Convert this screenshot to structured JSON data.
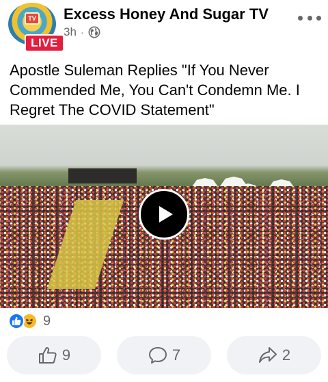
{
  "post": {
    "page_name": "Excess Honey And Sugar TV",
    "time": "3h",
    "meta_separator": "·",
    "live_label": "LIVE",
    "avatar_badge_text": "TV",
    "text": "Apostle Suleman Replies \"If You Never Commended Me, You Can't Condemn Me. I Regret The COVID Statement\""
  },
  "reactions": {
    "count": "9"
  },
  "actions": {
    "like_count": "9",
    "comment_count": "7",
    "share_count": "2"
  },
  "colors": {
    "live_red": "#e41e3f",
    "like_blue": "#1877f2",
    "haha_yellow": "#f7b928",
    "secondary_text": "#65676b",
    "button_bg": "#f0f2f5"
  },
  "icons": {
    "more": "more-horizontal-icon",
    "privacy": "globe-icon",
    "play": "play-icon",
    "like": "thumbs-up-icon",
    "comment": "comment-bubble-icon",
    "share": "share-arrow-icon"
  }
}
